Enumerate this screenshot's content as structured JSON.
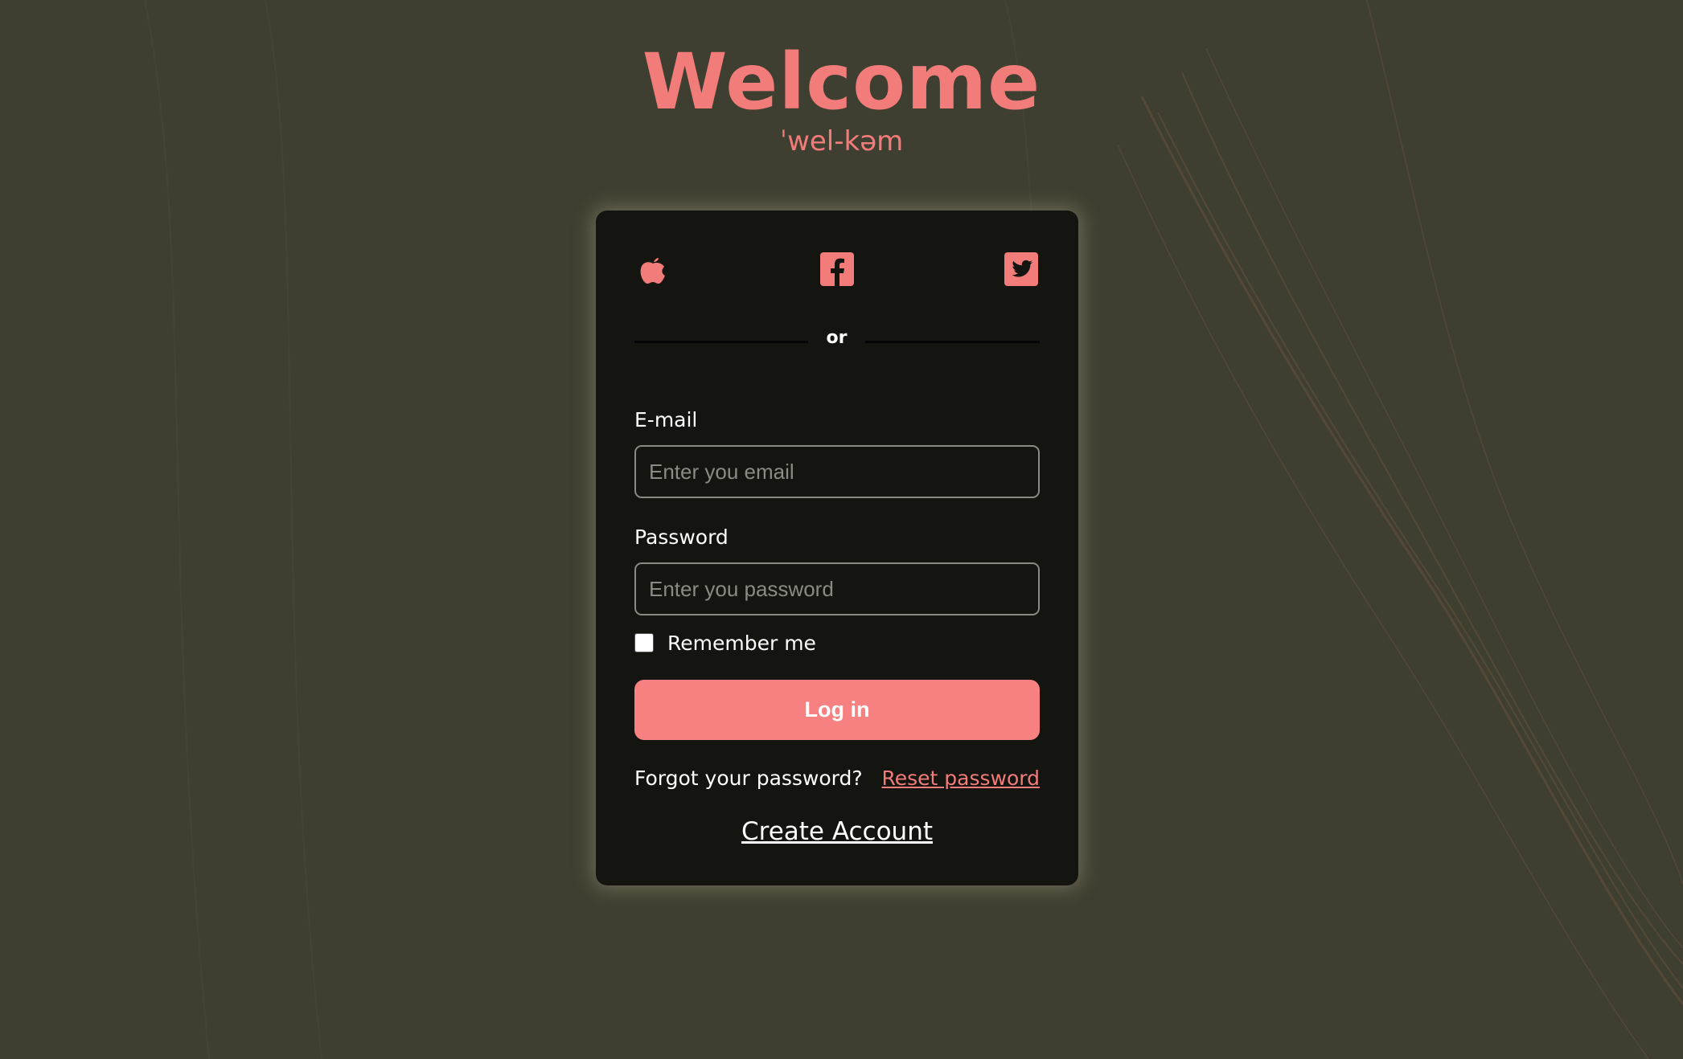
{
  "header": {
    "title": "Welcome",
    "subtitle": "ˈwel-kəm"
  },
  "social": {
    "items": [
      {
        "name": "apple",
        "icon": "apple-icon"
      },
      {
        "name": "facebook",
        "icon": "facebook-icon"
      },
      {
        "name": "twitter",
        "icon": "twitter-icon"
      }
    ]
  },
  "divider": {
    "text": "or"
  },
  "form": {
    "email_label": "E-mail",
    "email_placeholder": "Enter you email",
    "email_value": "",
    "password_label": "Password",
    "password_placeholder": "Enter you password",
    "password_value": "",
    "remember_label": "Remember me",
    "remember_checked": false,
    "login_label": "Log in"
  },
  "footer": {
    "forgot_text": "Forgot your password?",
    "reset_label": "Reset password",
    "create_label": "Create Account"
  },
  "colors": {
    "background": "#3f3f31",
    "card": "#141410",
    "accent": "#f27c7a",
    "button": "#f78181",
    "text": "#ffffff"
  }
}
